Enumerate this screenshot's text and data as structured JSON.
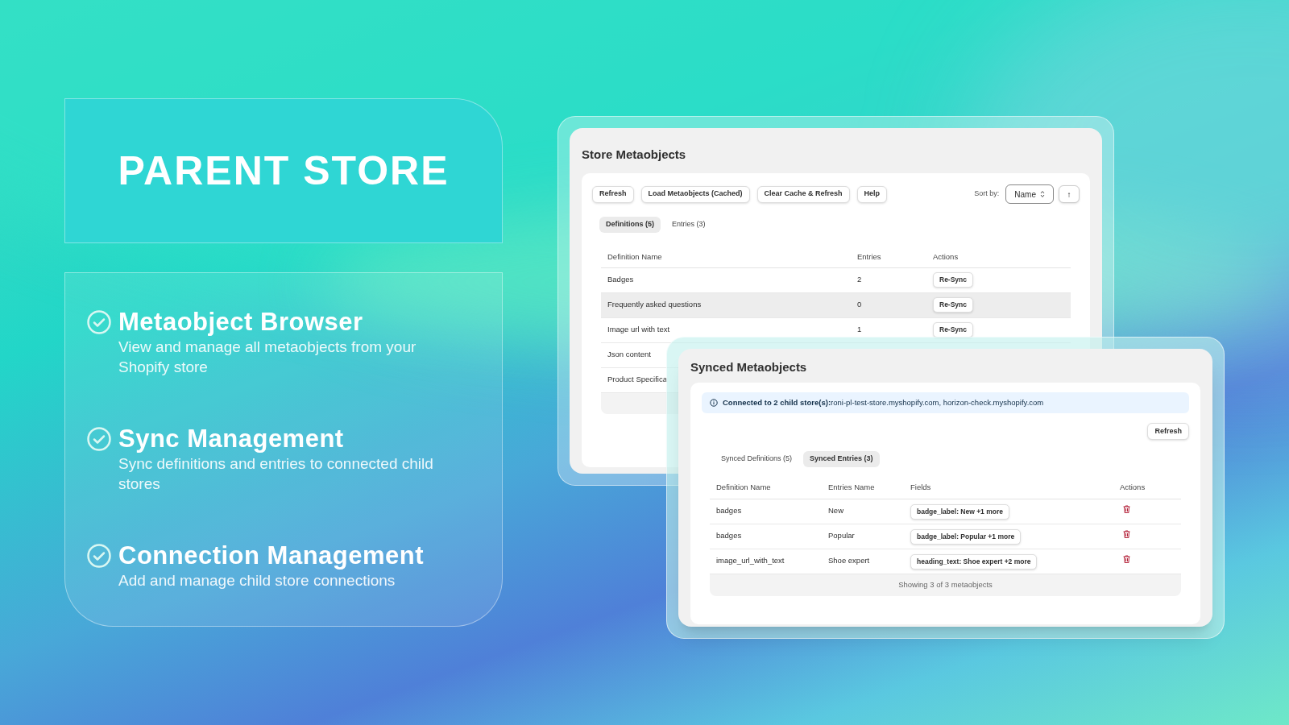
{
  "hero": {
    "title": "PARENT STORE"
  },
  "features": [
    {
      "title": "Metaobject Browser",
      "description": "View and manage all metaobjects from your Shopify store"
    },
    {
      "title": "Sync Management",
      "description": "Sync definitions and entries to connected child stores"
    },
    {
      "title": "Connection Management",
      "description": "Add and manage child store connections"
    }
  ],
  "store_window": {
    "title": "Store Metaobjects",
    "toolbar": [
      "Refresh",
      "Load Metaobjects (Cached)",
      "Clear Cache & Refresh",
      "Help"
    ],
    "sort_label": "Sort by:",
    "sort_value": "Name",
    "sort_direction": "↑",
    "tabs": [
      {
        "label": "Definitions (5)",
        "selected": true
      },
      {
        "label": "Entries (3)",
        "selected": false
      }
    ],
    "columns": [
      "Definition Name",
      "Entries",
      "Actions"
    ],
    "rows": [
      {
        "name": "Badges",
        "entries": "2",
        "action": "Re-Sync",
        "highlighted": false
      },
      {
        "name": "Frequently asked questions",
        "entries": "0",
        "action": "Re-Sync",
        "highlighted": true
      },
      {
        "name": "Image url with text",
        "entries": "1",
        "action": "Re-Sync",
        "highlighted": false
      },
      {
        "name": "Json content",
        "highlighted": false
      },
      {
        "name": "Product Specifica",
        "highlighted": false
      }
    ]
  },
  "synced_window": {
    "title": "Synced Metaobjects",
    "banner": "**Connected to 2 child store(s):**roni-pl-test-store.myshopify.com, horizon-check.myshopify.com",
    "refresh": "Refresh",
    "tabs": [
      {
        "label": "Synced Definitions (5)",
        "selected": false
      },
      {
        "label": "Synced Entries (3)",
        "selected": true
      }
    ],
    "columns": [
      "Definition Name",
      "Entries Name",
      "Fields",
      "Actions"
    ],
    "rows": [
      {
        "definition": "badges",
        "entry": "New",
        "fields": "badge_label: New +1 more"
      },
      {
        "definition": "badges",
        "entry": "Popular",
        "fields": "badge_label: Popular +1 more"
      },
      {
        "definition": "image_url_with_text",
        "entry": "Shoe expert",
        "fields": "heading_text: Shoe expert +2 more"
      }
    ],
    "footer": "Showing 3 of 3 metaobjects"
  }
}
